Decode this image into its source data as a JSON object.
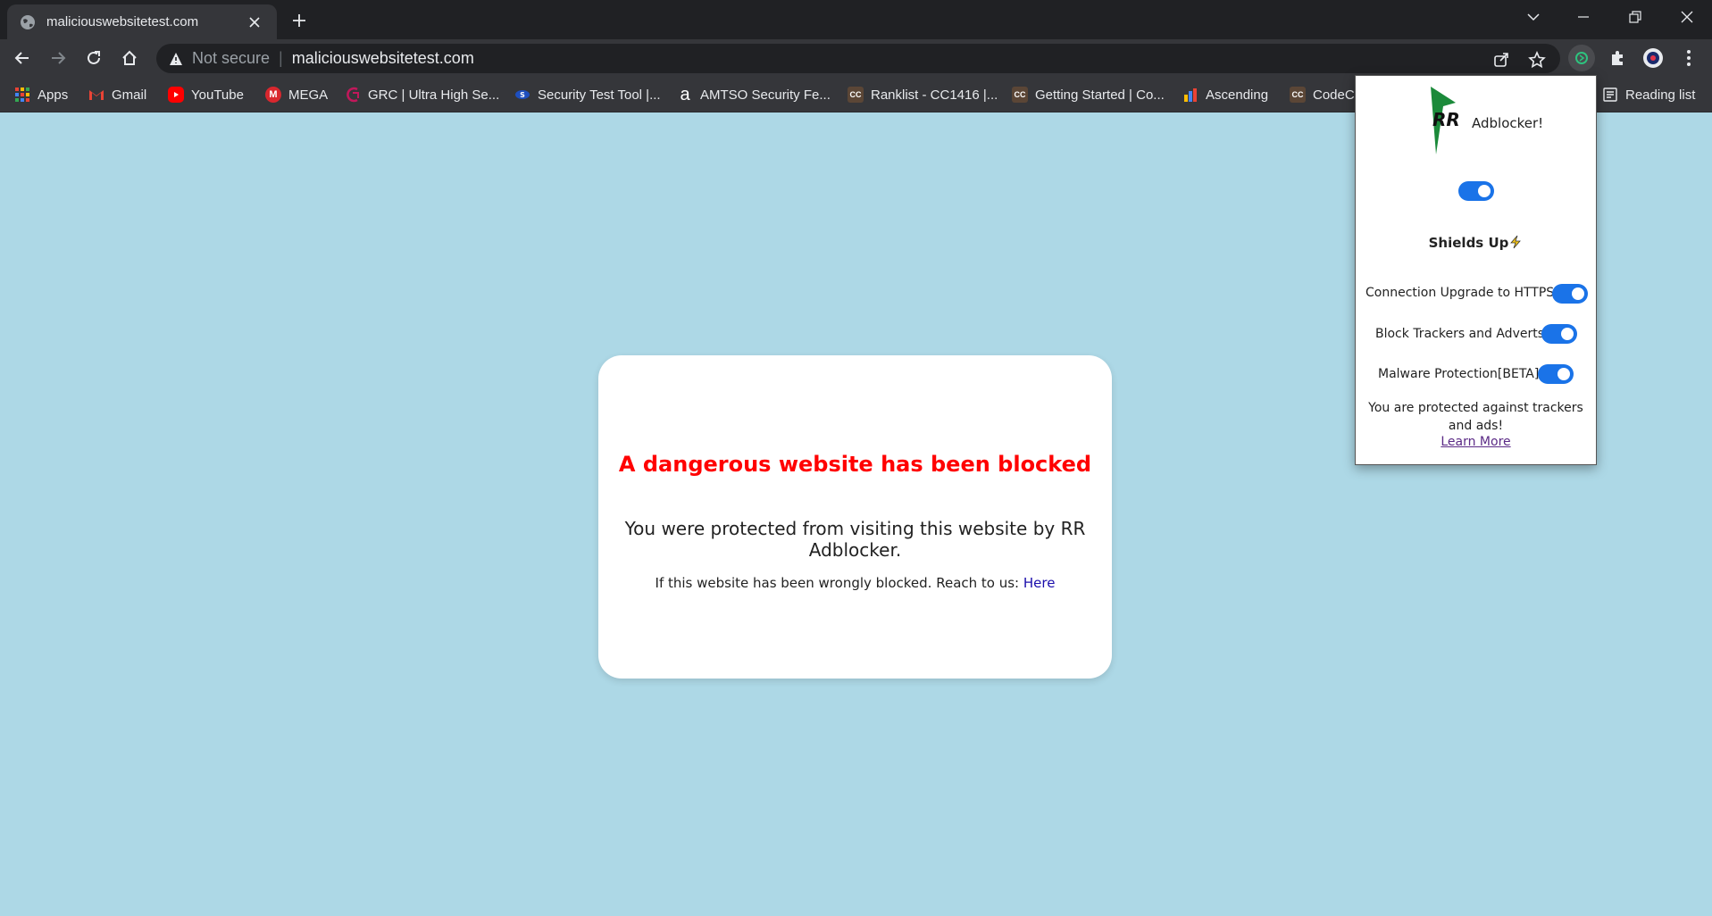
{
  "browser": {
    "tab_title": "maliciouswebsitetest.com",
    "address_security": "Not secure",
    "address_url": "maliciouswebsitetest.com",
    "reading_list": "Reading list"
  },
  "bookmarks": [
    {
      "label": "Apps",
      "icon": "apps-grid-icon"
    },
    {
      "label": "Gmail",
      "icon": "gmail-icon"
    },
    {
      "label": "YouTube",
      "icon": "youtube-icon"
    },
    {
      "label": "MEGA",
      "icon": "mega-icon"
    },
    {
      "label": "GRC | Ultra High Se...",
      "icon": "grc-icon"
    },
    {
      "label": "Security Test Tool |...",
      "icon": "security-tool-icon"
    },
    {
      "label": "AMTSO Security Fe...",
      "icon": "amtso-icon"
    },
    {
      "label": "Ranklist - CC1416 |...",
      "icon": "codechef-icon"
    },
    {
      "label": "Getting Started | Co...",
      "icon": "codechef-icon"
    },
    {
      "label": "Ascending",
      "icon": "bar-chart-icon"
    },
    {
      "label": "CodeC",
      "icon": "codechef-icon"
    }
  ],
  "page": {
    "title": "A dangerous website has been blocked",
    "message": "You were protected from visiting this website by RR Adblocker.",
    "note": "If this website has been wrongly blocked. Reach to us:",
    "note_link": "Here"
  },
  "popup": {
    "logo_text": "RR",
    "brand": "Adblocker!",
    "main_toggle": true,
    "shields": "Shields Up",
    "options": [
      {
        "label": "Connection Upgrade to HTTPS",
        "enabled": true
      },
      {
        "label": "Block Trackers and Adverts",
        "enabled": true
      },
      {
        "label": "Malware Protection[BETA]",
        "enabled": true
      }
    ],
    "status": "You are protected against trackers and ads!",
    "learn_more": "Learn More"
  },
  "colors": {
    "page_bg": "#add8e6",
    "danger": "#ff0000",
    "toggle_on": "#1a73e8",
    "chrome_dark": "#202124",
    "chrome_mid": "#35363a"
  }
}
